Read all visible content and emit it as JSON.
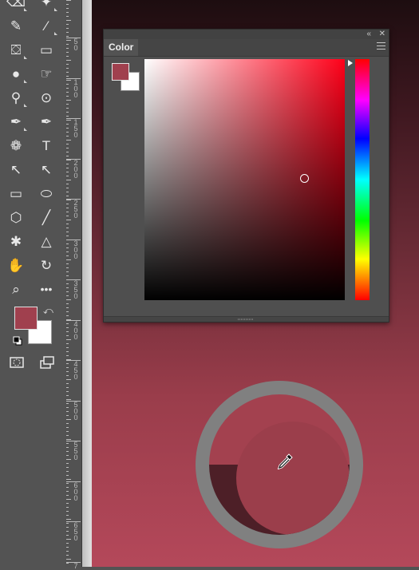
{
  "toolbar": {
    "tools": [
      {
        "icon": "eraser-icon",
        "glyph": "⌫",
        "sub": true
      },
      {
        "icon": "magic-wand-icon",
        "glyph": "✦",
        "sub": true
      },
      {
        "icon": "pencil-icon",
        "glyph": "✎",
        "sub": false
      },
      {
        "icon": "brush-icon",
        "glyph": "⁄",
        "sub": true
      },
      {
        "icon": "paint-bucket-icon",
        "glyph": "⛋",
        "sub": true
      },
      {
        "icon": "gradient-icon",
        "glyph": "▭",
        "sub": false
      },
      {
        "icon": "blur-icon",
        "glyph": "●",
        "sub": true
      },
      {
        "icon": "smudge-icon",
        "glyph": "☞",
        "sub": false
      },
      {
        "icon": "dodge-icon",
        "glyph": "⚲",
        "sub": true
      },
      {
        "icon": "sponge-icon",
        "glyph": "⊙",
        "sub": false
      },
      {
        "icon": "pen-icon",
        "glyph": "✒",
        "sub": true
      },
      {
        "icon": "freeform-pen-icon",
        "glyph": "✒",
        "sub": false
      },
      {
        "icon": "pattern-stamp-icon",
        "glyph": "❁",
        "sub": false
      },
      {
        "icon": "type-icon",
        "glyph": "T",
        "sub": false
      },
      {
        "icon": "path-selection-icon",
        "glyph": "↖",
        "sub": false
      },
      {
        "icon": "direct-selection-icon",
        "glyph": "↖",
        "sub": false
      },
      {
        "icon": "rectangle-icon",
        "glyph": "▭",
        "sub": false
      },
      {
        "icon": "ellipse-icon",
        "glyph": "⬭",
        "sub": false
      },
      {
        "icon": "polygon-icon",
        "glyph": "⬡",
        "sub": false
      },
      {
        "icon": "line-icon",
        "glyph": "╱",
        "sub": false
      },
      {
        "icon": "custom-shape-icon",
        "glyph": "✱",
        "sub": false
      },
      {
        "icon": "triangle-icon",
        "glyph": "△",
        "sub": false
      },
      {
        "icon": "hand-icon",
        "glyph": "✋",
        "sub": false
      },
      {
        "icon": "rotate-view-icon",
        "glyph": "↻",
        "sub": false
      },
      {
        "icon": "zoom-icon",
        "glyph": "⌕",
        "sub": false
      },
      {
        "icon": "more-tools-icon",
        "glyph": "•••",
        "sub": false
      }
    ],
    "foreground_color": "#a0404e",
    "background_color": "#ffffff"
  },
  "ruler": {
    "labels": [
      "50",
      "100",
      "150",
      "200",
      "250",
      "300",
      "350",
      "400",
      "450",
      "500",
      "550",
      "600",
      "650",
      "7"
    ]
  },
  "color_panel": {
    "tab_label": "Color",
    "collapse_glyph": "«",
    "close_glyph": "✕",
    "hue_color": "#ff0019",
    "picker_color": "#a0404e"
  },
  "loupe": {
    "new_color": "#a3414f",
    "current_color": "#4d1f27"
  }
}
